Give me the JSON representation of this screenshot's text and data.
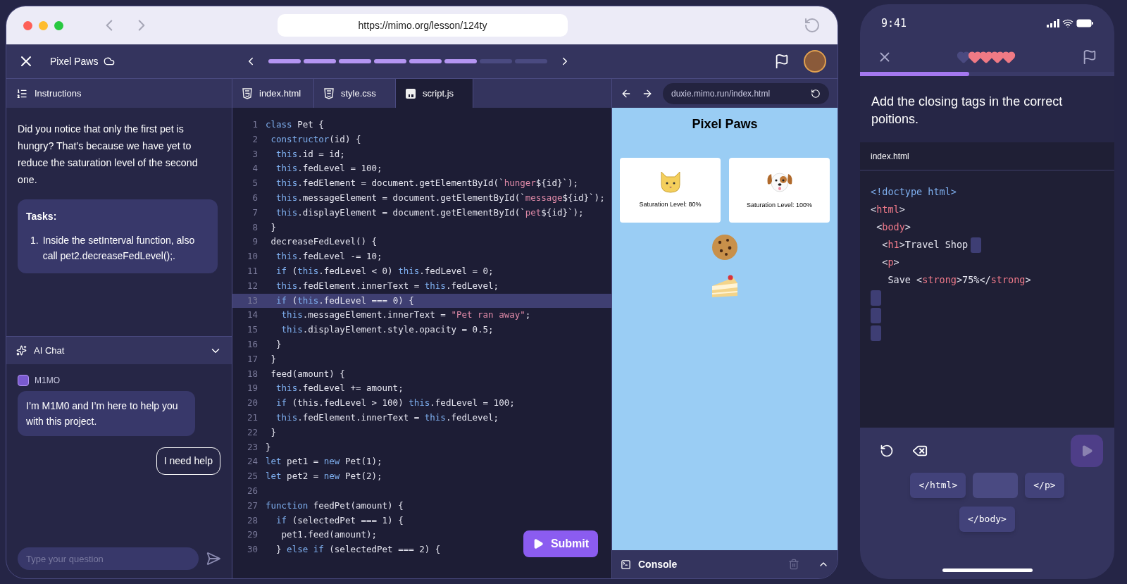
{
  "browser": {
    "url": "https://mimo.org/lesson/124ty"
  },
  "header": {
    "title": "Pixel Paws",
    "progress": [
      {
        "completed": true
      },
      {
        "completed": true
      },
      {
        "completed": true
      },
      {
        "completed": true
      },
      {
        "completed": true
      },
      {
        "completed": true
      },
      {
        "completed": false
      },
      {
        "completed": false
      }
    ]
  },
  "instructions": {
    "tab": "Instructions",
    "intro": "Did you notice that only the first pet is hungry? That’s because we have yet to reduce the saturation level of the second one.",
    "tasks_title": "Tasks:",
    "tasks": [
      {
        "number": "1.",
        "text": "Inside the setInterval function, also call pet2.decreaseFedLevel();."
      }
    ]
  },
  "chat": {
    "title": "AI Chat",
    "expanded": true,
    "messages": [
      {
        "kind": "bot",
        "sender": "M1MO",
        "text": "I’m M1M0 and I’m here to help you with this project."
      },
      {
        "kind": "user",
        "text": "I need help"
      }
    ],
    "input": {
      "placeholder": "Type your question"
    }
  },
  "editor": {
    "tabs": [
      {
        "label": "index.html",
        "kind": "html",
        "selected": false
      },
      {
        "label": "style.css",
        "kind": "css",
        "selected": false
      },
      {
        "label": "script.js",
        "kind": "js",
        "selected": true
      }
    ],
    "lines": [
      {
        "number": "1",
        "selected": false,
        "segments": [
          {
            "kind": "keyword",
            "text": "class"
          },
          {
            "kind": "plain",
            "text": " Pet {"
          }
        ]
      },
      {
        "number": "2",
        "selected": false,
        "segments": [
          {
            "kind": "keyword",
            "text": " constructor"
          },
          {
            "kind": "plain",
            "text": "(id) {"
          }
        ]
      },
      {
        "number": "3",
        "selected": false,
        "segments": [
          {
            "kind": "keyword",
            "text": "  this"
          },
          {
            "kind": "plain",
            "text": ".id = id;"
          }
        ]
      },
      {
        "number": "4",
        "selected": false,
        "segments": [
          {
            "kind": "keyword",
            "text": "  this"
          },
          {
            "kind": "plain",
            "text": ".fedLevel = 100;"
          }
        ]
      },
      {
        "number": "5",
        "selected": false,
        "segments": [
          {
            "kind": "keyword",
            "text": "  this"
          },
          {
            "kind": "plain",
            "text": ".fedElement = document.getElementById(`"
          },
          {
            "kind": "string",
            "text": "hunger"
          },
          {
            "kind": "plain",
            "text": "${id}`);"
          }
        ]
      },
      {
        "number": "6",
        "selected": false,
        "segments": [
          {
            "kind": "keyword",
            "text": "  this"
          },
          {
            "kind": "plain",
            "text": ".messageElement = document.getElementById(`"
          },
          {
            "kind": "string",
            "text": "message"
          },
          {
            "kind": "plain",
            "text": "${id}`);"
          }
        ]
      },
      {
        "number": "7",
        "selected": false,
        "segments": [
          {
            "kind": "keyword",
            "text": "  this"
          },
          {
            "kind": "plain",
            "text": ".displayElement = document.getElementById(`"
          },
          {
            "kind": "string",
            "text": "pet"
          },
          {
            "kind": "plain",
            "text": "${id}`);"
          }
        ]
      },
      {
        "number": "8",
        "selected": false,
        "segments": [
          {
            "kind": "plain",
            "text": " }"
          }
        ]
      },
      {
        "number": "9",
        "selected": false,
        "segments": [
          {
            "kind": "plain",
            "text": " decreaseFedLevel() {"
          }
        ]
      },
      {
        "number": "10",
        "selected": false,
        "segments": [
          {
            "kind": "keyword",
            "text": "  this"
          },
          {
            "kind": "plain",
            "text": ".fedLevel -= 10;"
          }
        ]
      },
      {
        "number": "11",
        "selected": false,
        "segments": [
          {
            "kind": "keyword",
            "text": "  if"
          },
          {
            "kind": "plain",
            "text": " ("
          },
          {
            "kind": "keyword",
            "text": "this"
          },
          {
            "kind": "plain",
            "text": ".fedLevel < 0) "
          },
          {
            "kind": "keyword",
            "text": "this"
          },
          {
            "kind": "plain",
            "text": ".fedLevel = 0;"
          }
        ]
      },
      {
        "number": "12",
        "selected": false,
        "segments": [
          {
            "kind": "keyword",
            "text": "  this"
          },
          {
            "kind": "plain",
            "text": ".fedElement.innerText = "
          },
          {
            "kind": "keyword",
            "text": "this"
          },
          {
            "kind": "plain",
            "text": ".fedLevel;"
          }
        ]
      },
      {
        "number": "13",
        "selected": true,
        "segments": [
          {
            "kind": "keyword",
            "text": "  if"
          },
          {
            "kind": "plain",
            "text": " ("
          },
          {
            "kind": "keyword",
            "text": "this"
          },
          {
            "kind": "plain",
            "text": ".fedLevel === 0) {"
          }
        ]
      },
      {
        "number": "14",
        "selected": false,
        "segments": [
          {
            "kind": "keyword",
            "text": "   this"
          },
          {
            "kind": "plain",
            "text": ".messageElement.innerText = "
          },
          {
            "kind": "string",
            "text": "\"Pet ran away\""
          },
          {
            "kind": "plain",
            "text": ";"
          }
        ]
      },
      {
        "number": "15",
        "selected": false,
        "segments": [
          {
            "kind": "keyword",
            "text": "   this"
          },
          {
            "kind": "plain",
            "text": ".displayElement.style.opacity = 0.5;"
          }
        ]
      },
      {
        "number": "16",
        "selected": false,
        "segments": [
          {
            "kind": "plain",
            "text": "  }"
          }
        ]
      },
      {
        "number": "17",
        "selected": false,
        "segments": [
          {
            "kind": "plain",
            "text": " }"
          }
        ]
      },
      {
        "number": "18",
        "selected": false,
        "segments": [
          {
            "kind": "plain",
            "text": " feed(amount) {"
          }
        ]
      },
      {
        "number": "19",
        "selected": false,
        "segments": [
          {
            "kind": "keyword",
            "text": "  this"
          },
          {
            "kind": "plain",
            "text": ".fedLevel += amount;"
          }
        ]
      },
      {
        "number": "20",
        "selected": false,
        "segments": [
          {
            "kind": "keyword",
            "text": "  if"
          },
          {
            "kind": "plain",
            "text": " (this.fedLevel > 100) "
          },
          {
            "kind": "keyword",
            "text": "this"
          },
          {
            "kind": "plain",
            "text": ".fedLevel = 100;"
          }
        ]
      },
      {
        "number": "21",
        "selected": false,
        "segments": [
          {
            "kind": "keyword",
            "text": "  this"
          },
          {
            "kind": "plain",
            "text": ".fedElement.innerText = "
          },
          {
            "kind": "keyword",
            "text": "this"
          },
          {
            "kind": "plain",
            "text": ".fedLevel;"
          }
        ]
      },
      {
        "number": "22",
        "selected": false,
        "segments": [
          {
            "kind": "plain",
            "text": " }"
          }
        ]
      },
      {
        "number": "23",
        "selected": false,
        "segments": [
          {
            "kind": "plain",
            "text": "}"
          }
        ]
      },
      {
        "number": "24",
        "selected": false,
        "segments": [
          {
            "kind": "keyword",
            "text": "let"
          },
          {
            "kind": "plain",
            "text": " pet1 = "
          },
          {
            "kind": "keyword",
            "text": "new"
          },
          {
            "kind": "plain",
            "text": " Pet(1);"
          }
        ]
      },
      {
        "number": "25",
        "selected": false,
        "segments": [
          {
            "kind": "keyword",
            "text": "let"
          },
          {
            "kind": "plain",
            "text": " pet2 = "
          },
          {
            "kind": "keyword",
            "text": "new"
          },
          {
            "kind": "plain",
            "text": " Pet(2);"
          }
        ]
      },
      {
        "number": "26",
        "selected": false
      },
      {
        "number": "27",
        "selected": false,
        "segments": [
          {
            "kind": "keyword",
            "text": "function"
          },
          {
            "kind": "plain",
            "text": " feedPet(amount) {"
          }
        ]
      },
      {
        "number": "28",
        "selected": false,
        "segments": [
          {
            "kind": "keyword",
            "text": "  if"
          },
          {
            "kind": "plain",
            "text": " (selectedPet === 1) {"
          }
        ]
      },
      {
        "number": "29",
        "selected": false,
        "segments": [
          {
            "kind": "plain",
            "text": "   pet1.feed(amount);"
          }
        ]
      },
      {
        "number": "30",
        "selected": false,
        "segments": [
          {
            "kind": "plain",
            "text": "  } "
          },
          {
            "kind": "keyword",
            "text": "else if"
          },
          {
            "kind": "plain",
            "text": " (selectedPet === 2) {"
          }
        ]
      }
    ],
    "submit": "Submit"
  },
  "preview": {
    "url": "duxie.mimo.run/index.html",
    "title": "Pixel Paws",
    "pets": [
      {
        "kind": "cat",
        "caption": "Saturation Level: 80%"
      },
      {
        "kind": "dog",
        "caption": "Saturation Level: 100%"
      }
    ],
    "foods": [
      {
        "kind": "cookie"
      },
      {
        "kind": "cake"
      }
    ],
    "console": "Console"
  },
  "phone": {
    "time": "9:41",
    "hearts": [
      {
        "filled": false
      },
      {
        "filled": true
      },
      {
        "filled": true
      },
      {
        "filled": true
      },
      {
        "filled": true
      }
    ],
    "level": 0.43,
    "prompt": "Add the closing tags in the correct poitions.",
    "file": "index.html",
    "lines": [
      {
        "segments": [
          {
            "kind": "doctype",
            "text": "<!doctype html>"
          }
        ]
      },
      {
        "segments": [
          {
            "kind": "plain",
            "text": "<"
          },
          {
            "kind": "tag",
            "text": "html"
          },
          {
            "kind": "plain",
            "text": ">"
          }
        ]
      },
      {
        "segments": [
          {
            "kind": "plain",
            "text": " <"
          },
          {
            "kind": "tag",
            "text": "body"
          },
          {
            "kind": "plain",
            "text": ">"
          }
        ]
      },
      {
        "segments": [
          {
            "kind": "plain",
            "text": "  <"
          },
          {
            "kind": "tag",
            "text": "h1"
          },
          {
            "kind": "plain",
            "text": ">Travel Shop"
          },
          {
            "kind": "slot"
          }
        ]
      },
      {
        "segments": [
          {
            "kind": "plain",
            "text": "  <"
          },
          {
            "kind": "tag",
            "text": "p"
          },
          {
            "kind": "plain",
            "text": ">"
          }
        ]
      },
      {
        "segments": [
          {
            "kind": "plain",
            "text": "   Save <"
          },
          {
            "kind": "tag",
            "text": "strong"
          },
          {
            "kind": "plain",
            "text": ">75%</"
          },
          {
            "kind": "tag",
            "text": "strong"
          },
          {
            "kind": "plain",
            "text": ">"
          }
        ]
      },
      {
        "segments": [
          {
            "kind": "slot"
          }
        ]
      },
      {
        "segments": [
          {
            "kind": "slot"
          }
        ]
      },
      {
        "segments": [
          {
            "kind": "slot"
          }
        ]
      }
    ],
    "chips": [
      {
        "kind": "tag",
        "label": "</html>"
      },
      {
        "kind": "placeholder"
      },
      {
        "kind": "tag",
        "label": "</p>"
      },
      {
        "kind": "tag",
        "label": "</body>"
      }
    ]
  }
}
